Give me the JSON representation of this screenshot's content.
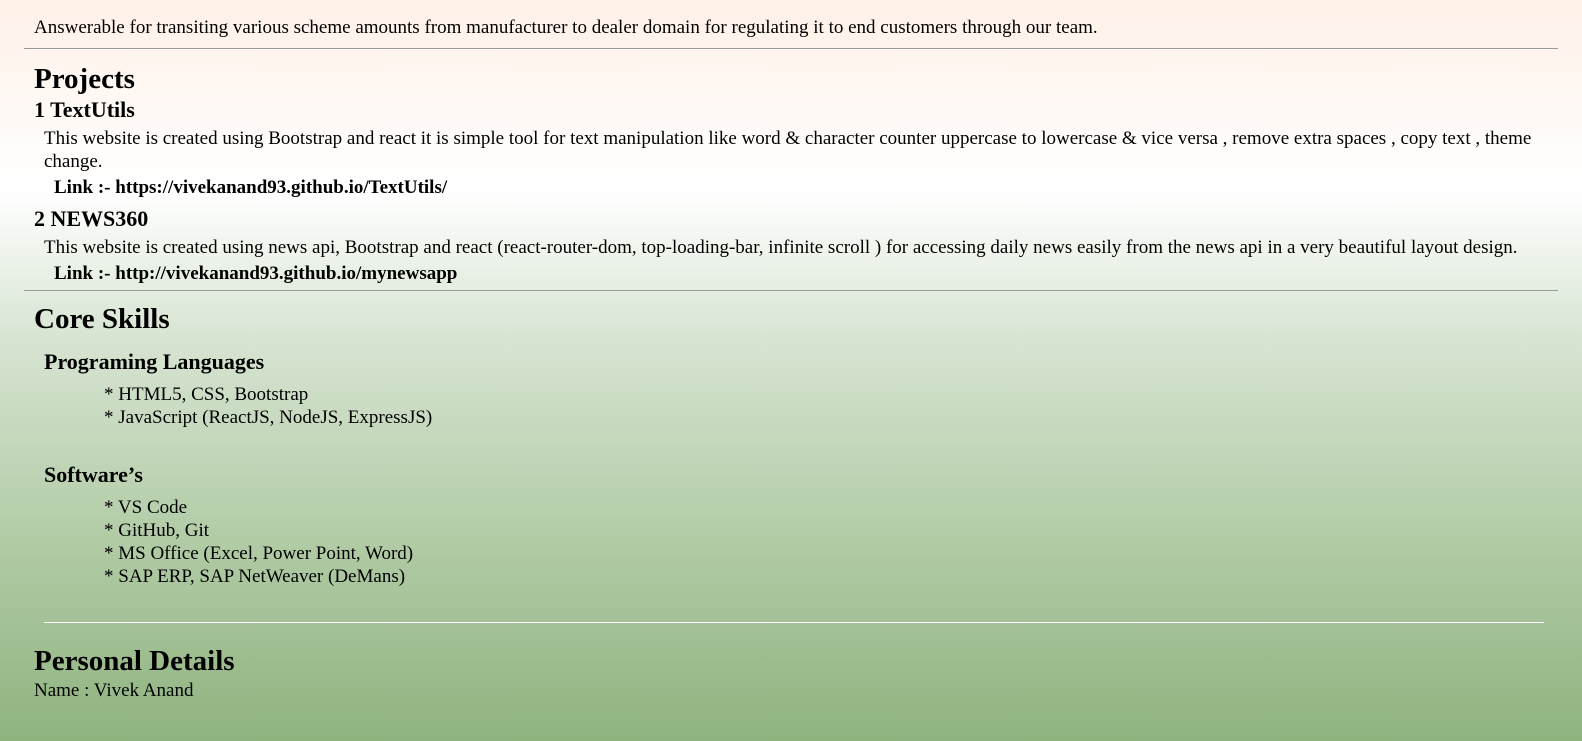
{
  "intro_text": "Answerable for transiting various scheme amounts from manufacturer to dealer domain for regulating it to end customers through our team.",
  "projects": {
    "heading": "Projects",
    "items": [
      {
        "title": "1 TextUtils",
        "description": "This website is created using Bootstrap and react it is simple tool for text manipulation like word & character counter uppercase to lowercase & vice versa , remove extra spaces , copy text , theme change.",
        "link_label": "Link :-",
        "link_url": "https://vivekanand93.github.io/TextUtils/"
      },
      {
        "title": "2 NEWS360",
        "description": "This website is created using news api, Bootstrap and react (react-router-dom, top-loading-bar, infinite scroll ) for accessing daily news easily from the news api in a very beautiful layout design.",
        "link_label": "Link :-",
        "link_url": "http://vivekanand93.github.io/mynewsapp"
      }
    ]
  },
  "core_skills": {
    "heading": "Core Skills",
    "groups": [
      {
        "title": "Programing Languages",
        "items": [
          "* HTML5, CSS, Bootstrap",
          "* JavaScript (ReactJS, NodeJS, ExpressJS)"
        ]
      },
      {
        "title": "Software’s",
        "items": [
          "* VS Code",
          "* GitHub, Git",
          "* MS Office (Excel, Power Point, Word)",
          "* SAP ERP, SAP NetWeaver (DeMans)"
        ]
      }
    ]
  },
  "personal_details": {
    "heading": "Personal Details",
    "name_line": "Name : Vivek Anand"
  },
  "colors": {
    "gradient_top": "#fff1e8",
    "gradient_bottom": "#8fb37f",
    "divider": "#9a9a9a"
  }
}
